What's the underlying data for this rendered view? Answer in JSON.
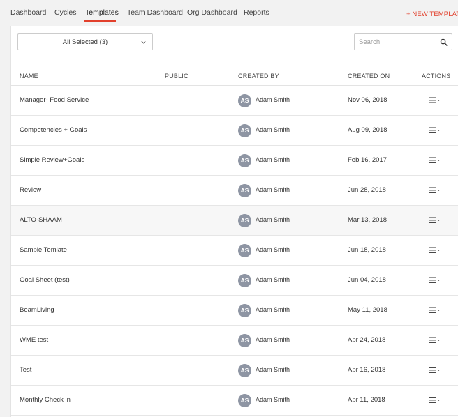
{
  "nav": {
    "items": [
      {
        "label": "Dashboard",
        "active": false
      },
      {
        "label": "Cycles",
        "active": false
      },
      {
        "label": "Templates",
        "active": true
      },
      {
        "label": "Team Dashboard",
        "active": false
      },
      {
        "label": "Org Dashboard",
        "active": false
      },
      {
        "label": "Reports",
        "active": false
      }
    ],
    "new_template_label": "+ NEW TEMPLATE"
  },
  "filter": {
    "selected_label": "All Selected (3)",
    "icon": "chevron-down-icon"
  },
  "search": {
    "placeholder": "Search",
    "value": "",
    "icon": "search-icon"
  },
  "table": {
    "headers": {
      "name": "NAME",
      "public": "PUBLIC",
      "created_by": "CREATED BY",
      "created_on": "CREATED ON",
      "actions": "ACTIONS"
    },
    "rows": [
      {
        "name": "Manager- Food Service",
        "public": "",
        "avatar": "AS",
        "created_by": "Adam Smith",
        "created_on": "Nov 06, 2018"
      },
      {
        "name": "Competencies + Goals",
        "public": "",
        "avatar": "AS",
        "created_by": "Adam Smith",
        "created_on": "Aug 09, 2018"
      },
      {
        "name": "Simple Review+Goals",
        "public": "",
        "avatar": "AS",
        "created_by": "Adam Smith",
        "created_on": "Feb 16, 2017"
      },
      {
        "name": "Review",
        "public": "",
        "avatar": "AS",
        "created_by": "Adam Smith",
        "created_on": "Jun 28, 2018"
      },
      {
        "name": "ALTO-SHAAM",
        "public": "",
        "avatar": "AS",
        "created_by": "Adam Smith",
        "created_on": "Mar 13, 2018",
        "highlighted": true
      },
      {
        "name": "Sample Temlate",
        "public": "",
        "avatar": "AS",
        "created_by": "Adam Smith",
        "created_on": "Jun 18, 2018"
      },
      {
        "name": "Goal Sheet (test)",
        "public": "",
        "avatar": "AS",
        "created_by": "Adam Smith",
        "created_on": "Jun 04, 2018"
      },
      {
        "name": "BeamLiving",
        "public": "",
        "avatar": "AS",
        "created_by": "Adam Smith",
        "created_on": "May 11, 2018"
      },
      {
        "name": "WME test",
        "public": "",
        "avatar": "AS",
        "created_by": "Adam Smith",
        "created_on": "Apr 24, 2018"
      },
      {
        "name": "Test",
        "public": "",
        "avatar": "AS",
        "created_by": "Adam Smith",
        "created_on": "Apr 16, 2018"
      },
      {
        "name": "Monthly Check in",
        "public": "",
        "avatar": "AS",
        "created_by": "Adam Smith",
        "created_on": "Apr 11, 2018"
      }
    ]
  },
  "colors": {
    "accent": "#e2402c",
    "avatar_bg": "#8e95a3",
    "page_bg": "#f2f2f2"
  }
}
